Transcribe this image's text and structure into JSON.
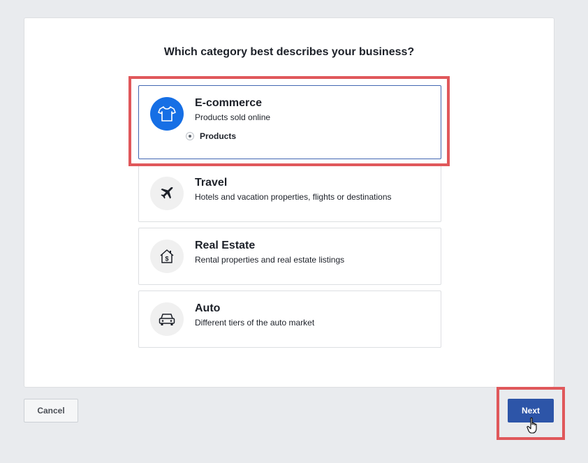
{
  "question": "Which category best describes your business?",
  "categories": [
    {
      "title": "E-commerce",
      "subtitle": "Products sold online",
      "icon": "tshirt-icon",
      "selected": true,
      "option_label": "Products"
    },
    {
      "title": "Travel",
      "subtitle": "Hotels and vacation properties, flights or destinations",
      "icon": "airplane-icon",
      "selected": false
    },
    {
      "title": "Real Estate",
      "subtitle": "Rental properties and real estate listings",
      "icon": "house-dollar-icon",
      "selected": false
    },
    {
      "title": "Auto",
      "subtitle": "Different tiers of the auto market",
      "icon": "car-icon",
      "selected": false
    }
  ],
  "footer": {
    "cancel_label": "Cancel",
    "next_label": "Next"
  },
  "colors": {
    "accent": "#2d55a8",
    "selected_icon_bg": "#166fe5",
    "highlight": "#e0585b"
  }
}
